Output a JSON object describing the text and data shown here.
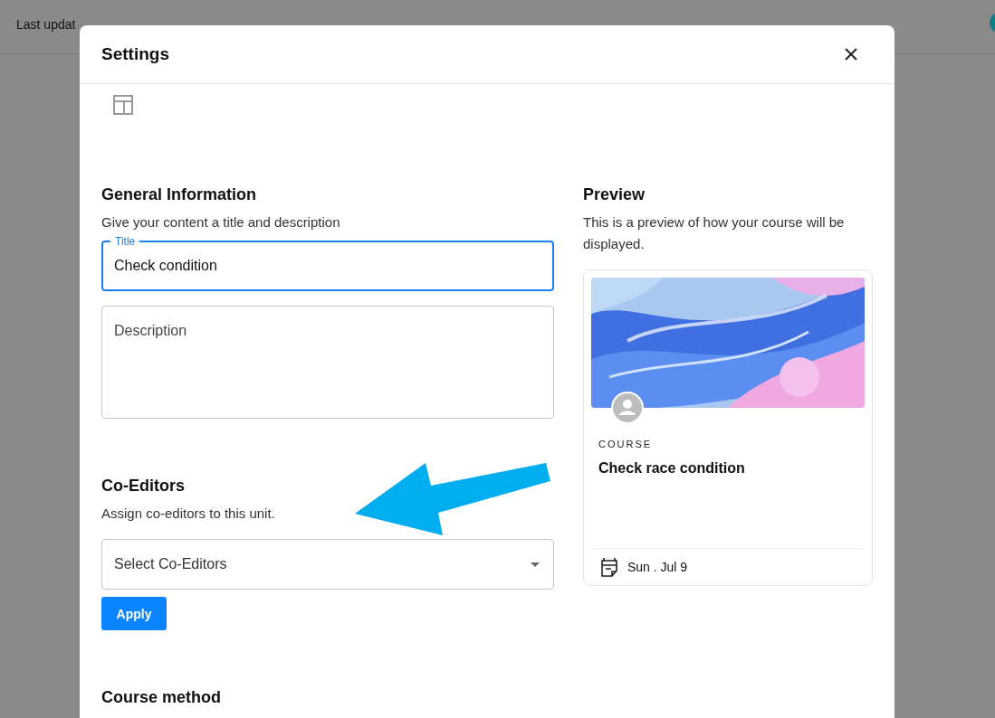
{
  "page": {
    "last_updated": "Last updat"
  },
  "dialog": {
    "title": "Settings",
    "general": {
      "heading": "General Information",
      "subtitle": "Give your content a title and description",
      "title_field": {
        "label": "Title",
        "value": "Check condition",
        "focused": true
      },
      "description_field": {
        "placeholder": "Description"
      }
    },
    "co_editors": {
      "heading": "Co-Editors",
      "subtitle": "Assign co-editors to this unit.",
      "select": {
        "placeholder": "Select Co-Editors"
      },
      "apply_button": "Apply"
    },
    "course_method": {
      "heading": "Course method"
    },
    "preview": {
      "heading": "Preview",
      "subtitle": "This is a preview of how your course will be displayed.",
      "card": {
        "kind": "picture",
        "type_label": "COURSE",
        "title": "Check race condition",
        "date": "Sun . Jul 9"
      }
    }
  }
}
